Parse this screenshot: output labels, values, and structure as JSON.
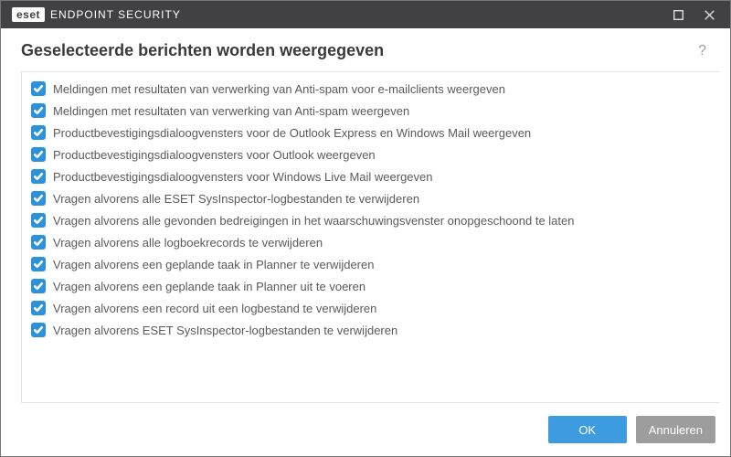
{
  "titlebar": {
    "brand_badge": "eset",
    "product": "ENDPOINT SECURITY"
  },
  "header": {
    "title": "Geselecteerde berichten worden weergegeven",
    "help": "?"
  },
  "list": {
    "items": [
      {
        "checked": true,
        "label": "Meldingen met resultaten van verwerking van Anti-spam voor e-mailclients weergeven"
      },
      {
        "checked": true,
        "label": "Meldingen met resultaten van verwerking van Anti-spam weergeven"
      },
      {
        "checked": true,
        "label": "Productbevestigingsdialoogvensters voor de Outlook Express en Windows Mail weergeven"
      },
      {
        "checked": true,
        "label": "Productbevestigingsdialoogvensters voor Outlook weergeven"
      },
      {
        "checked": true,
        "label": "Productbevestigingsdialoogvensters voor Windows Live Mail weergeven"
      },
      {
        "checked": true,
        "label": "Vragen alvorens alle ESET SysInspector-logbestanden te verwijderen"
      },
      {
        "checked": true,
        "label": "Vragen alvorens alle gevonden bedreigingen in het waarschuwingsvenster onopgeschoond te laten"
      },
      {
        "checked": true,
        "label": "Vragen alvorens alle logboekrecords te verwijderen"
      },
      {
        "checked": true,
        "label": "Vragen alvorens een geplande taak in Planner te verwijderen"
      },
      {
        "checked": true,
        "label": "Vragen alvorens een geplande taak in Planner uit te voeren"
      },
      {
        "checked": true,
        "label": "Vragen alvorens een record uit een logbestand te verwijderen"
      },
      {
        "checked": true,
        "label": "Vragen alvorens ESET SysInspector-logbestanden te verwijderen"
      }
    ]
  },
  "footer": {
    "ok": "OK",
    "cancel": "Annuleren"
  },
  "colors": {
    "accent": "#3d9be0",
    "checkbox": "#2a91db",
    "titlebar": "#414042"
  }
}
